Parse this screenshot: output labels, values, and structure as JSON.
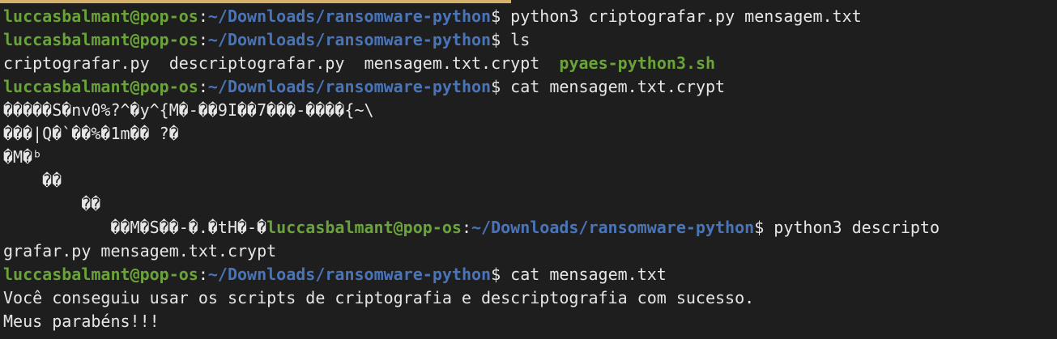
{
  "prompt": {
    "user_host": "luccasbalmant@pop-os",
    "sep": ":",
    "path": "~/Downloads/ransomware-python",
    "symbol": "$ "
  },
  "lines": [
    {
      "cmd": "python3 criptografar.py mensagem.txt"
    },
    {
      "cmd": "ls"
    },
    {
      "files": [
        "criptografar.py",
        "descriptografar.py",
        "mensagem.txt.crypt"
      ],
      "exec_file": "pyaes-python3.sh"
    },
    {
      "cmd": "cat mensagem.txt.crypt"
    },
    {
      "garbage": "�����S�nv0%?^�y^{M�-��9I��7���-����{~\\"
    },
    {
      "garbage": "���|Q�`��%�1m�� ?�"
    },
    {
      "garbage": "�M�ᵇ"
    },
    {
      "garbage": "    ��"
    },
    {
      "garbage": "        ��"
    },
    {
      "garbage": "           ��M�S��-�.�tH�-�",
      "cmd": "python3 descripto"
    },
    {
      "output": "grafar.py mensagem.txt.crypt"
    },
    {
      "cmd": "cat mensagem.txt"
    },
    {
      "output": "Você conseguiu usar os scripts de criptografia e descriptografia com sucesso."
    },
    {
      "output": "Meus parabéns!!!"
    }
  ],
  "colors": {
    "background": "#1e1e1e",
    "foreground": "#e6e6e6",
    "user_host": "#6ba33b",
    "path": "#4a74b8",
    "executable": "#6ba33b",
    "accent_bar": "#d6b26b"
  }
}
